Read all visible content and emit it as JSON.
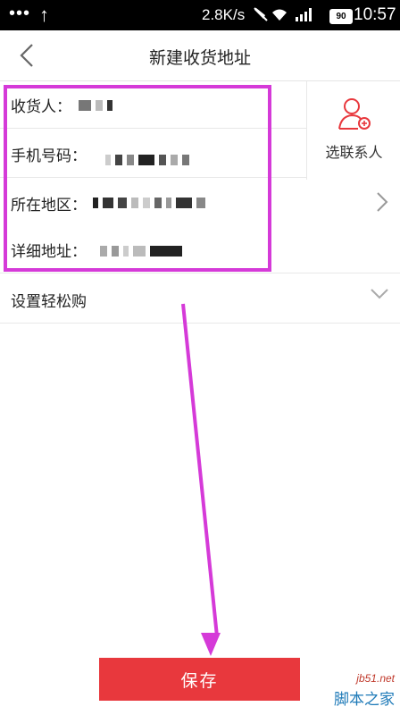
{
  "status_bar": {
    "dots": "•••",
    "network_speed": "2.8K/s",
    "battery": "90",
    "time": "10:57"
  },
  "header": {
    "title": "新建收货地址"
  },
  "form": {
    "recipient_label": "收货人：",
    "phone_label": "手机号码：",
    "region_label": "所在地区：",
    "address_label": "详细地址："
  },
  "contact": {
    "label": "选联系人"
  },
  "easy_buy": {
    "label": "设置轻松购"
  },
  "save_button": {
    "label": "保存"
  },
  "watermark": {
    "url": "jb51.net",
    "name": "脚本之家"
  },
  "colors": {
    "accent_red": "#e8383d",
    "highlight_magenta": "#d53ad8",
    "status_bar_bg": "#000000"
  },
  "icons": [
    "back-chevron-icon",
    "add-contact-icon",
    "chevron-right-icon",
    "chevron-down-icon",
    "wifi-icon",
    "signal-icon",
    "battery-icon"
  ]
}
